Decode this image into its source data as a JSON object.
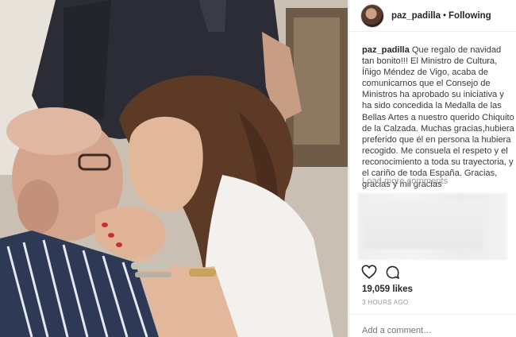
{
  "post": {
    "username": "paz_padilla",
    "separator": "•",
    "follow_status": "Following",
    "caption_user": "paz_padilla",
    "caption_text": "Que regalo de navidad tan bonito!!! El Ministro de Cultura, Íñigo Méndez de Vigo, acaba de comunicarnos que el Consejo de Ministros ha aprobado su iniciativa y ha sido concedida la Medalla de las Bellas Artes a nuestro querido Chiquito de la Calzada. Muchas gracias,hubiera preferido que él en persona la hubiera recogido. Me consuela el respeto y el reconocimiento a toda su trayectoria, y el cariño de toda España. Gracias, gracias y mil gracias",
    "load_more": "Load more comments",
    "likes": "19,059 likes",
    "time": "3 HOURS AGO",
    "comment_placeholder": "Add a comment…"
  },
  "icons": {
    "like": "heart-icon",
    "comment": "speech-bubble-icon"
  }
}
